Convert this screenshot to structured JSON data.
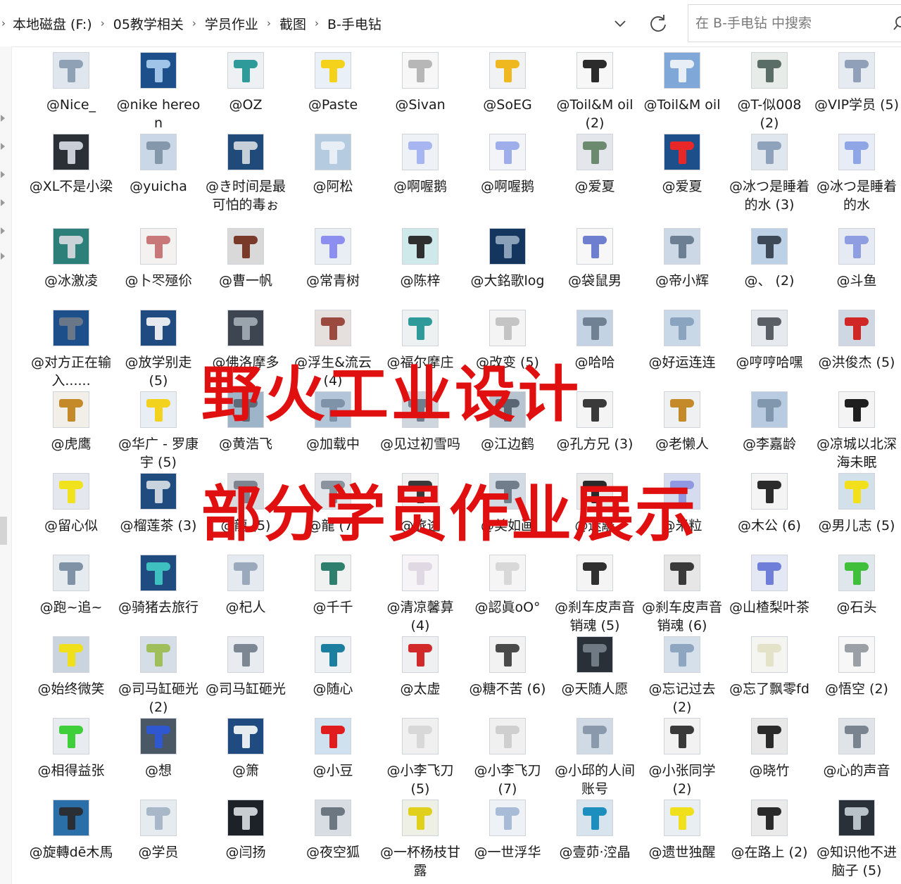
{
  "address_bar": {
    "breadcrumb": [
      "本地磁盘 (F:)",
      "05教学相关",
      "学员作业",
      "截图",
      "B-手电钻"
    ]
  },
  "search": {
    "placeholder": "在 B-手电钻 中搜索"
  },
  "watermark": {
    "line1": "野火工业设计",
    "line2": "部分学员作业展示"
  },
  "files": [
    {
      "label": "@Nice_",
      "bg": "#dfe6ee",
      "gun": "#8fa2b5"
    },
    {
      "label": "@nike hereon",
      "bg": "#1d4f8a",
      "gun": "#9fc4e8"
    },
    {
      "label": "@OZ",
      "bg": "#eef1f3",
      "gun": "#2f9a9a"
    },
    {
      "label": "@Paste",
      "bg": "#eaf0f7",
      "gun": "#f4d21c"
    },
    {
      "label": "@Sivan",
      "bg": "#f7f7f7",
      "gun": "#b7b7b7"
    },
    {
      "label": "@SoEG",
      "bg": "#f0f2f4",
      "gun": "#f0b820"
    },
    {
      "label": "@Toil&M oil (2)",
      "bg": "#f7f7f7",
      "gun": "#2b2b2b"
    },
    {
      "label": "@Toil&M oil",
      "bg": "#7fa8d8",
      "gun": "#e8eef5"
    },
    {
      "label": "@T-似008 (2)",
      "bg": "#e7ece9",
      "gun": "#5a6d66"
    },
    {
      "label": "@VIP学员 (5)",
      "bg": "#e6ebf1",
      "gun": "#8fa0b8"
    },
    {
      "label": "@XL不是小梁",
      "bg": "#2b2f36",
      "gun": "#c9ced6"
    },
    {
      "label": "@yuicha",
      "bg": "#c9d7e6",
      "gun": "#8497ab"
    },
    {
      "label": "@き时间是最可怕的毒ぉ",
      "bg": "#1f4a7a",
      "gun": "#c6cfd8"
    },
    {
      "label": "@阿松",
      "bg": "#b5cbe0",
      "gun": "#e8eef5"
    },
    {
      "label": "@啊喔鹅",
      "bg": "#eef1f6",
      "gun": "#a7b6f0"
    },
    {
      "label": "@啊喔鹅",
      "bg": "#f2f4f8",
      "gun": "#9eaeea"
    },
    {
      "label": "@爱夏",
      "bg": "#e3e6ea",
      "gun": "#6c8a6e"
    },
    {
      "label": "@爱夏",
      "bg": "#1d4f8a",
      "gun": "#e82828"
    },
    {
      "label": "@冰つ是睡着的水 (3)",
      "bg": "#dfe6ee",
      "gun": "#8ea2bb"
    },
    {
      "label": "@冰つ是睡着的水",
      "bg": "#e8ecf6",
      "gun": "#8fa6e6"
    },
    {
      "label": "@冰激凌",
      "bg": "#2d7f7a",
      "gun": "#c9d3d7"
    },
    {
      "label": "@卜罖殛伱",
      "bg": "#f4f2f1",
      "gun": "#c9787a"
    },
    {
      "label": "@曹一帆",
      "bg": "#d9d9d9",
      "gun": "#7a3a2a"
    },
    {
      "label": "@常青树",
      "bg": "#e9edf4",
      "gun": "#8c8ef0"
    },
    {
      "label": "@陈梓",
      "bg": "#cfe8ea",
      "gun": "#2f2f2f"
    },
    {
      "label": "@大銘歌log",
      "bg": "#14365e",
      "gun": "#8aa0b8"
    },
    {
      "label": "@袋鼠男",
      "bg": "#f7f7f7",
      "gun": "#6f7fd0"
    },
    {
      "label": "@帝小辉",
      "bg": "#cdd8e6",
      "gun": "#6c7f93"
    },
    {
      "label": "@、 (2)",
      "bg": "#bcd0e6",
      "gun": "#3d4957"
    },
    {
      "label": "@斗鱼",
      "bg": "#e6ebf3",
      "gun": "#8e9ee0"
    },
    {
      "label": "@对方正在输入......",
      "bg": "#1d4f8a",
      "gun": "#6a7788"
    },
    {
      "label": "@放学别走 (5)",
      "bg": "#1f4b80",
      "gun": "#e5e8ec"
    },
    {
      "label": "@佛洛摩多",
      "bg": "#3d4650",
      "gun": "#9aa4ad"
    },
    {
      "label": "@浮生&流云 (4)",
      "bg": "#e5dfdd",
      "gun": "#9a4a3e"
    },
    {
      "label": "@福尔摩庄",
      "bg": "#eef1f1",
      "gun": "#2f9a9a"
    },
    {
      "label": "@改变 (5)",
      "bg": "#f4f4f4",
      "gun": "#c4c4c4"
    },
    {
      "label": "@哈哈",
      "bg": "#c3d3e3",
      "gun": "#6f8193"
    },
    {
      "label": "@好运连连",
      "bg": "#c9d8e6",
      "gun": "#8aa4c0"
    },
    {
      "label": "@哼哼哈嘿",
      "bg": "#e6eaef",
      "gun": "#5a5f66"
    },
    {
      "label": "@洪俊杰 (5)",
      "bg": "#cfd8e2",
      "gun": "#d12626"
    },
    {
      "label": "@虎鹰",
      "bg": "#f2efe8",
      "gun": "#c48a2a"
    },
    {
      "label": "@华广 - 罗康宇 (5)",
      "bg": "#e8eef4",
      "gun": "#f2d21c"
    },
    {
      "label": "@黄浩飞",
      "bg": "#9eb4c9",
      "gun": "#5e6c7a"
    },
    {
      "label": "@加载中",
      "bg": "#b2c5d9",
      "gun": "#7e93a8"
    },
    {
      "label": "@见过初雪吗",
      "bg": "#cfd6de",
      "gun": "#6f7f8f"
    },
    {
      "label": "@江边鹤",
      "bg": "#b7c3cf",
      "gun": "#5a6674"
    },
    {
      "label": "@孔方兄 (3)",
      "bg": "#f4f4f4",
      "gun": "#3a3a3a"
    },
    {
      "label": "@老懒人",
      "bg": "#eef0f2",
      "gun": "#c48a2a"
    },
    {
      "label": "@李嘉龄",
      "bg": "#b9cbe0",
      "gun": "#8197ad"
    },
    {
      "label": "@凉城以北深海未眠",
      "bg": "#f4f4f4",
      "gun": "#1f1f1f"
    },
    {
      "label": "@留心似",
      "bg": "#e4e8ee",
      "gun": "#f0e21c"
    },
    {
      "label": "@榴莲茶 (3)",
      "bg": "#1f4b7f",
      "gun": "#c9d3dd"
    },
    {
      "label": "@龍 (5)",
      "bg": "#d6d9dd",
      "gun": "#7d8690"
    },
    {
      "label": "@龍 (7)",
      "bg": "#e2e5e9",
      "gun": "#8a939d"
    },
    {
      "label": "@旅途",
      "bg": "#f0f0f0",
      "gun": "#3a3a3a"
    },
    {
      "label": "@美如画",
      "bg": "#d2dae3",
      "gun": "#707d8b"
    },
    {
      "label": "@迷離",
      "bg": "#eaeaea",
      "gun": "#2a2a2a"
    },
    {
      "label": "@米粒",
      "bg": "#d6dcef",
      "gun": "#8f98e0"
    },
    {
      "label": "@木公 (6)",
      "bg": "#f4f4f4",
      "gun": "#2b2b2b"
    },
    {
      "label": "@男儿志 (5)",
      "bg": "#d2e0ea",
      "gun": "#f2e01c"
    },
    {
      "label": "@跑~追~",
      "bg": "#e6ebf0",
      "gun": "#7f92a6"
    },
    {
      "label": "@骑猪去旅行",
      "bg": "#1f4b80",
      "gun": "#3fc0c0"
    },
    {
      "label": "@杞人",
      "bg": "#e4eaf0",
      "gun": "#9aaabc"
    },
    {
      "label": "@千千",
      "bg": "#f0f2f2",
      "gun": "#2f7f6f"
    },
    {
      "label": "@清凉馨萛 (4)",
      "bg": "#f6f4f6",
      "gun": "#e0d8e2"
    },
    {
      "label": "@認眞oO°",
      "bg": "#f5f5f5",
      "gun": "#d8d8d8"
    },
    {
      "label": "@刹车皮声音销魂 (5)",
      "bg": "#f4f4f4",
      "gun": "#303030"
    },
    {
      "label": "@刹车皮声音销魂 (6)",
      "bg": "#e6e6e6",
      "gun": "#3a3a3a"
    },
    {
      "label": "@山楂梨叶茶",
      "bg": "#e4e8f4",
      "gun": "#6f7ed8"
    },
    {
      "label": "@石头",
      "bg": "#dfe6ec",
      "gun": "#3fbf3a"
    },
    {
      "label": "@始终微笑",
      "bg": "#c9d4de",
      "gun": "#f0e01c"
    },
    {
      "label": "@司马缸砸光 (2)",
      "bg": "#d5dde6",
      "gun": "#9fbf5a"
    },
    {
      "label": "@司马缸砸光",
      "bg": "#e8ecf0",
      "gun": "#7c8793"
    },
    {
      "label": "@随心",
      "bg": "#eef1f3",
      "gun": "#1c7f9f"
    },
    {
      "label": "@太虚",
      "bg": "#eef0f2",
      "gun": "#d22a2a"
    },
    {
      "label": "@糖不苦 (6)",
      "bg": "#f2f2f2",
      "gun": "#4a4a4a"
    },
    {
      "label": "@天随人愿",
      "bg": "#2a3038",
      "gun": "#6f7a84"
    },
    {
      "label": "@忘记过去 (2)",
      "bg": "#d6e0ea",
      "gun": "#8ea6c0"
    },
    {
      "label": "@忘了飘零fd",
      "bg": "#f4f4f0",
      "gun": "#e4e2c8"
    },
    {
      "label": "@悟空 (2)",
      "bg": "#f7f7f7",
      "gun": "#9aa0a6"
    },
    {
      "label": "@相得益张",
      "bg": "#e8ecf0",
      "gun": "#3fcf3a"
    },
    {
      "label": "@想",
      "bg": "#4a5866",
      "gun": "#2f58d0"
    },
    {
      "label": "@箫",
      "bg": "#1f4b80",
      "gun": "#e6ebf0"
    },
    {
      "label": "@小豆",
      "bg": "#cfe0ef",
      "gun": "#e01c1c"
    },
    {
      "label": "@小李飞刀 (5)",
      "bg": "#f0f0f0",
      "gun": "#d8d8d8"
    },
    {
      "label": "@小李飞刀 (7)",
      "bg": "#f0f0f0",
      "gun": "#cfcfcf"
    },
    {
      "label": "@小邱的人间账号",
      "bg": "#d0dae4",
      "gun": "#8a9aac"
    },
    {
      "label": "@小张同学 (2)",
      "bg": "#f2f2f2",
      "gun": "#3a3a3a"
    },
    {
      "label": "@晓竹",
      "bg": "#e8e8e8",
      "gun": "#2a2a2a"
    },
    {
      "label": "@心的声音",
      "bg": "#e0e4e8",
      "gun": "#7a8490"
    },
    {
      "label": "@旋轉dē木馬",
      "bg": "#2a6fa8",
      "gun": "#2a2f36"
    },
    {
      "label": "@学员",
      "bg": "#e6ebf0",
      "gun": "#a8b8c8"
    },
    {
      "label": "@闫扬",
      "bg": "#1d2228",
      "gun": "#c8cdd2"
    },
    {
      "label": "@夜空狐",
      "bg": "#d7dde3",
      "gun": "#6d7782"
    },
    {
      "label": "@一杯杨枝甘露",
      "bg": "#eef0e6",
      "gun": "#e0d01c"
    },
    {
      "label": "@一世浮华",
      "bg": "#eef2f7",
      "gun": "#a8bcd8"
    },
    {
      "label": "@壹茆·涳晶",
      "bg": "#d7e4ee",
      "gun": "#1c8fbf"
    },
    {
      "label": "@遗世独醒",
      "bg": "#e8eef2",
      "gun": "#f0e01c"
    },
    {
      "label": "@在路上 (2)",
      "bg": "#eaeaea",
      "gun": "#2a2a2a"
    },
    {
      "label": "@知识他不进脑子 (5)",
      "bg": "#2a3038",
      "gun": "#b8c0c8"
    }
  ]
}
